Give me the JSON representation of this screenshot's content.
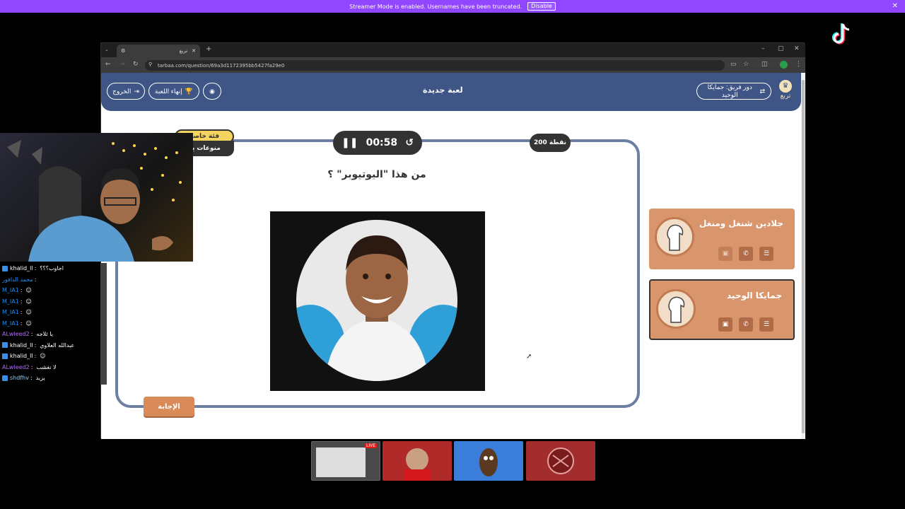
{
  "banner": {
    "text": "Streamer Mode is enabled. Usernames have been truncated.",
    "disable": "Disable"
  },
  "browser": {
    "tab_title": "تربع",
    "url": "tarbaa.com/question/69a3d1172395bb5427fa29e0"
  },
  "app": {
    "title": "لعبة جديدة",
    "turn_label": "دور فريق: جمايكا الوحيد",
    "exit": "الخروج",
    "end_game": "إنهاء اللعبة",
    "logo_text": "تربع"
  },
  "question": {
    "timer": "00:58",
    "points": "200 نقطة",
    "category": "فئة خاصة",
    "subcategory": "منوعات يو",
    "text": "من هذا \"اليوتيوبر\" ؟",
    "answer": "الإجابة"
  },
  "teams": [
    {
      "name": "جلادين شنغل ومنغل",
      "active": false
    },
    {
      "name": "جمايكا الوحيد",
      "active": true
    }
  ],
  "chat": [
    {
      "user": "khalid_ll",
      "msg": "اجاوب؟؟؟",
      "color": "#ffffff",
      "badge": true
    },
    {
      "user": "محمد الدافور",
      "msg": "",
      "color": "#1e90ff",
      "badge": false
    },
    {
      "user": "M_IA1",
      "msg": "☺",
      "color": "#1e90ff",
      "badge": false
    },
    {
      "user": "M_IA1",
      "msg": "☺",
      "color": "#1e90ff",
      "badge": false
    },
    {
      "user": "M_IA1",
      "msg": "☺",
      "color": "#1e90ff",
      "badge": false
    },
    {
      "user": "M_IA1",
      "msg": "☺",
      "color": "#1e90ff",
      "badge": false
    },
    {
      "user": "ALwleed2",
      "msg": "يا ثلاجه",
      "color": "#b36bff",
      "badge": false
    },
    {
      "user": "khalid_ll",
      "msg": "عبدالله العلاوي",
      "color": "#ffffff",
      "badge": true
    },
    {
      "user": "khalid_ll",
      "msg": "☺",
      "color": "#ffffff",
      "badge": true
    },
    {
      "user": "ALwleed2",
      "msg": "لا تغشب",
      "color": "#b36bff",
      "badge": false
    },
    {
      "user": "shdfhv",
      "msg": "يزيد",
      "color": "#8fd0ff",
      "badge": true
    }
  ],
  "thumbnails": [
    {
      "name": "screen",
      "live": "LIVE"
    },
    {
      "name": "player"
    },
    {
      "name": "character"
    },
    {
      "name": "logo"
    }
  ],
  "colors": {
    "header": "#3e5585",
    "team": "#d9956b",
    "twitch": "#9146ff"
  }
}
